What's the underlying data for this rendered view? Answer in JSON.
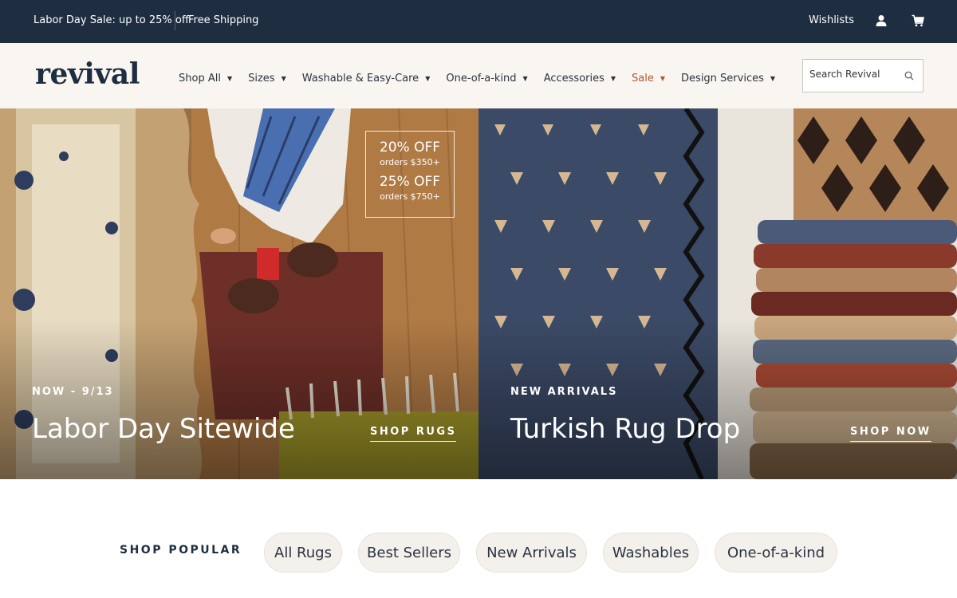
{
  "topbar": {
    "promo": "Labor Day Sale: up to 25% off",
    "shipping": "Free Shipping",
    "wishlists": "Wishlists",
    "account_icon": "account-icon",
    "cart_icon": "cart-icon"
  },
  "nav": {
    "logo": "revival",
    "items": [
      {
        "label": "Shop All"
      },
      {
        "label": "Sizes"
      },
      {
        "label": "Washable & Easy-Care"
      },
      {
        "label": "One-of-a-kind"
      },
      {
        "label": "Accessories"
      },
      {
        "label": "Sale"
      },
      {
        "label": "Design Services"
      }
    ],
    "search_placeholder": "Search Revival",
    "sale_color": "#b0552d"
  },
  "hero_left": {
    "offer": {
      "line1": "20% OFF",
      "line1_sub": "orders $350+",
      "line2": "25% OFF",
      "line2_sub": "orders $750+"
    },
    "kicker": "NOW - 9/13",
    "headline": "Labor Day Sitewide",
    "cta": "SHOP RUGS"
  },
  "hero_right": {
    "kicker": "NEW ARRIVALS",
    "headline": "Turkish Rug Drop",
    "cta": "SHOP NOW"
  },
  "popular": {
    "label": "SHOP POPULAR",
    "pills": [
      "All Rugs",
      "Best Sellers",
      "New Arrivals",
      "Washables",
      "One-of-a-kind"
    ]
  },
  "colors": {
    "topbar_bg": "#1e2d40",
    "nav_bg": "#f9f6f2",
    "pill_bg": "#f4f1ec"
  }
}
